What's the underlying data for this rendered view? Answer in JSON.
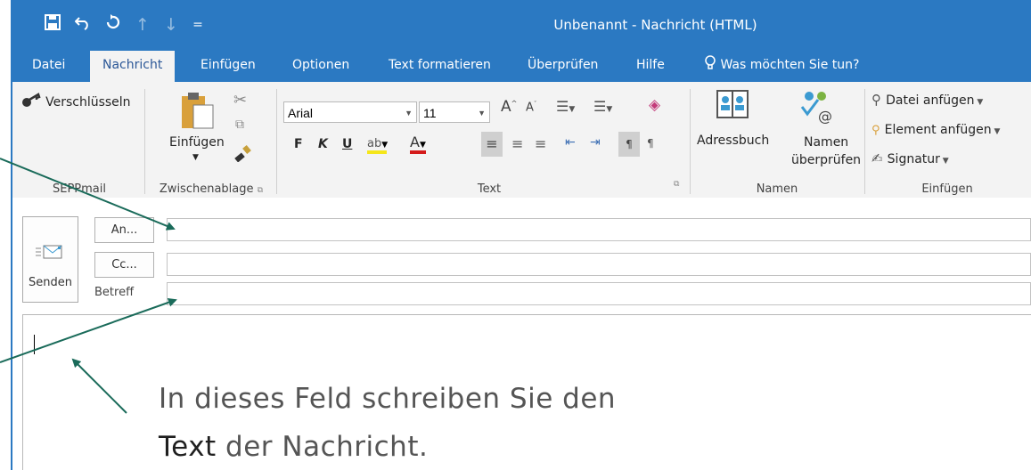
{
  "titlebar": {
    "title": "Unbenannt  -  Nachricht (HTML)",
    "icons": [
      "save-icon",
      "undo-icon",
      "redo-icon",
      "up-arrow-icon",
      "down-arrow-icon",
      "customize-icon"
    ]
  },
  "tabs": {
    "items": [
      "Datei",
      "Nachricht",
      "Einfügen",
      "Optionen",
      "Text formatieren",
      "Überprüfen",
      "Hilfe"
    ],
    "tell_me": "Was möchten Sie tun?",
    "active_index": 1
  },
  "ribbon": {
    "sepp": {
      "button": "Verschlüsseln",
      "label": "SEPPmail"
    },
    "clipboard": {
      "paste": "Einfügen",
      "label": "Zwischenablage"
    },
    "text": {
      "font": "Arial",
      "size": "11",
      "bold": "F",
      "italic": "K",
      "underline": "U",
      "label": "Text"
    },
    "names": {
      "addressbook": "Adressbuch",
      "check_names_1": "Namen",
      "check_names_2": "überprüfen",
      "label": "Namen"
    },
    "include": {
      "attach_file": "Datei anfügen",
      "attach_item": "Element anfügen",
      "signature": "Signatur",
      "label": "Einfügen"
    }
  },
  "compose": {
    "send": "Senden",
    "to": "An...",
    "cc": "Cc...",
    "subject": "Betreff",
    "to_value": "",
    "cc_value": "",
    "subject_value": ""
  },
  "annotation": {
    "line1": "In dieses Feld schreiben Sie den",
    "line2_bold": "Text",
    "line2_rest": " der Nachricht."
  },
  "colors": {
    "accent": "#2b79c2",
    "arrow": "#1a6b5a",
    "ribbon_bg": "#f3f3f3"
  }
}
